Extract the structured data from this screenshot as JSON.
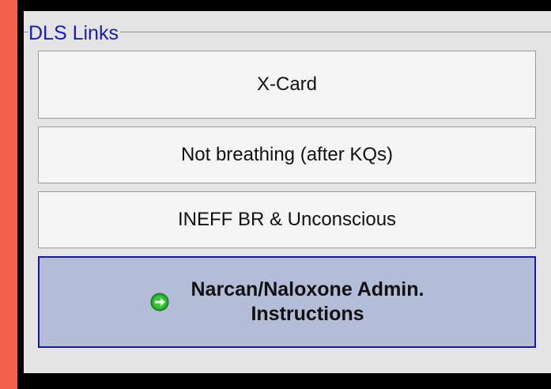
{
  "panel": {
    "title": "DLS Links",
    "buttons": [
      {
        "label": "X-Card"
      },
      {
        "label": "Not breathing (after KQs)"
      },
      {
        "label": "INEFF BR & Unconscious"
      },
      {
        "label": "Narcan/Naloxone Admin.\nInstructions",
        "icon": "arrow-right-icon"
      }
    ]
  },
  "colors": {
    "background": "#f4614a",
    "panel": "#e4e4e4",
    "title": "#1b1bb8",
    "highlight": "#b4bdd7",
    "highlight_border": "#19199e",
    "icon": "#22a826"
  }
}
